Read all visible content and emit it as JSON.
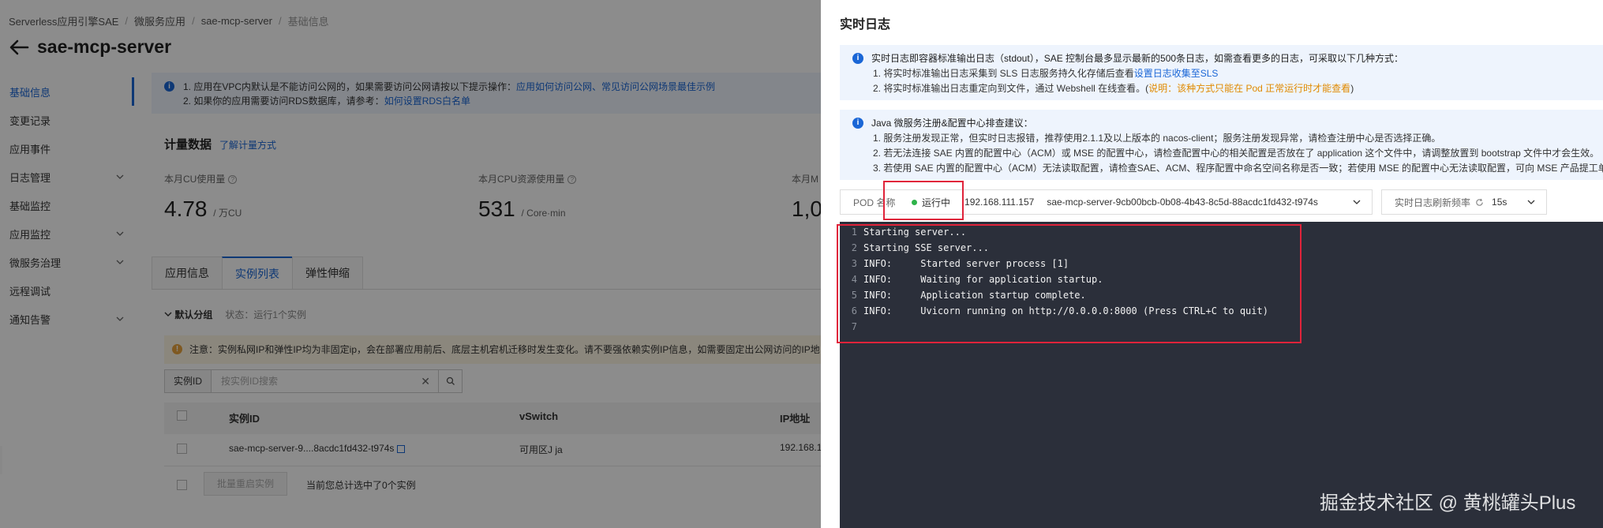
{
  "breadcrumb": [
    "Serverless应用引擎SAE",
    "微服务应用",
    "sae-mcp-server",
    "基础信息"
  ],
  "page_title": "sae-mcp-server",
  "sidenav": [
    {
      "label": "基础信息",
      "expandable": false
    },
    {
      "label": "变更记录",
      "expandable": false
    },
    {
      "label": "应用事件",
      "expandable": false
    },
    {
      "label": "日志管理",
      "expandable": true
    },
    {
      "label": "基础监控",
      "expandable": false
    },
    {
      "label": "应用监控",
      "expandable": true
    },
    {
      "label": "微服务治理",
      "expandable": true
    },
    {
      "label": "远程调试",
      "expandable": false
    },
    {
      "label": "通知告警",
      "expandable": true
    }
  ],
  "notice": {
    "line1_prefix": "1. 应用在VPC内默认是不能访问公网的，如果需要访问公网请按以下提示操作：",
    "line1_link": "应用如何访问公网、常见访问公网场景最佳示例",
    "line2_prefix": "2. 如果你的应用需要访问RDS数据库，请参考：",
    "line2_link": "如何设置RDS白名单"
  },
  "metrics": {
    "title": "计量数据",
    "link": "了解计量方式",
    "items": [
      {
        "label": "本月CU使用量",
        "value": "4.78",
        "unit": "/ 万CU"
      },
      {
        "label": "本月CPU资源使用量",
        "value": "531",
        "unit": "/ Core·min"
      },
      {
        "label": "本月M",
        "value": "1,0",
        "unit": ""
      }
    ]
  },
  "tabs": [
    "应用信息",
    "实例列表",
    "弹性伸缩"
  ],
  "group": {
    "name": "默认分组",
    "status": "状态：运行1个实例"
  },
  "warning": "注意：实例私网IP和弹性IP均为非固定ip，会在部署应用前后、底层主机宕机迁移时发生变化。请不要强依赖实例IP信息，如需要固定出公网访问的IP地",
  "search": {
    "label": "实例ID",
    "placeholder": "按实例ID搜索",
    "clear": "✕"
  },
  "table": {
    "headers": [
      "实例ID",
      "vSwitch",
      "IP地址"
    ],
    "rows": [
      {
        "instance_id": "sae-mcp-server-9....8acdc1fd432-t974s",
        "vswitch": "可用区J ja",
        "ip": "192.168.1"
      }
    ]
  },
  "footer": {
    "batch_restart": "批量重启实例",
    "selected_text": "当前您总计选中了0个实例"
  },
  "drawer": {
    "title": "实时日志",
    "callout1": {
      "head": "实时日志即容器标准输出日志（stdout），SAE 控制台最多显示最新的500条日志，如需查看更多的日志，可采取以下几种方式：",
      "line1_prefix": "1. 将实时标准输出日志采集到 SLS 日志服务持久化存储后查看",
      "line1_link": "设置日志收集至SLS",
      "line2_prefix": "2. 将实时标准输出日志重定向到文件，通过 Webshell 在线查看。(",
      "line2_note": "说明：该种方式只能在 Pod 正常运行时才能查看",
      "line2_suffix": ")"
    },
    "callout2": {
      "head": "Java 微服务注册&配置中心排查建议：",
      "lines": [
        "1. 服务注册发现正常，但实时日志报错，推荐使用2.1.1及以上版本的 nacos-client；服务注册发现异常，请检查注册中心是否选择正确。",
        "2. 若无法连接 SAE 内置的配置中心（ACM）或 MSE 的配置中心，请检查配置中心的相关配置是否放在了 application 这个文件中，请调整放置到 bootstrap 文件中才会生效。",
        "3. 若使用 SAE 内置的配置中心（ACM）无法读取配置，请检查SAE、ACM、程序配置中命名空间名称是否一致；若使用 MSE 的配置中心无法读取配置，可向 MSE 产品提工单"
      ]
    },
    "pod": {
      "label": "POD 名称",
      "status": "运行中",
      "ip": "192.168.111.157",
      "name": "sae-mcp-server-9cb00bcb-0b08-4b43-8c5d-88acdc1fd432-t974s"
    },
    "refresh": {
      "label": "实时日志刷新频率",
      "value": "15s"
    },
    "log_lines": [
      {
        "n": "1",
        "text": "Starting server..."
      },
      {
        "n": "2",
        "text": "Starting SSE server..."
      },
      {
        "n": "3",
        "text": "INFO:     Started server process [1]"
      },
      {
        "n": "4",
        "text": "INFO:     Waiting for application startup."
      },
      {
        "n": "5",
        "text": "INFO:     Application startup complete."
      },
      {
        "n": "6",
        "text": "INFO:     Uvicorn running on http://0.0.0.0:8000 (Press CTRL+C to quit)"
      },
      {
        "n": "7",
        "text": ""
      }
    ]
  },
  "watermark": "掘金技术社区 @ 黄桃罐头Plus",
  "colors": {
    "accent": "#1a66d6",
    "running": "#2eb34a",
    "highlight": "#e0233a",
    "terminal_bg": "#2b2f3a"
  }
}
